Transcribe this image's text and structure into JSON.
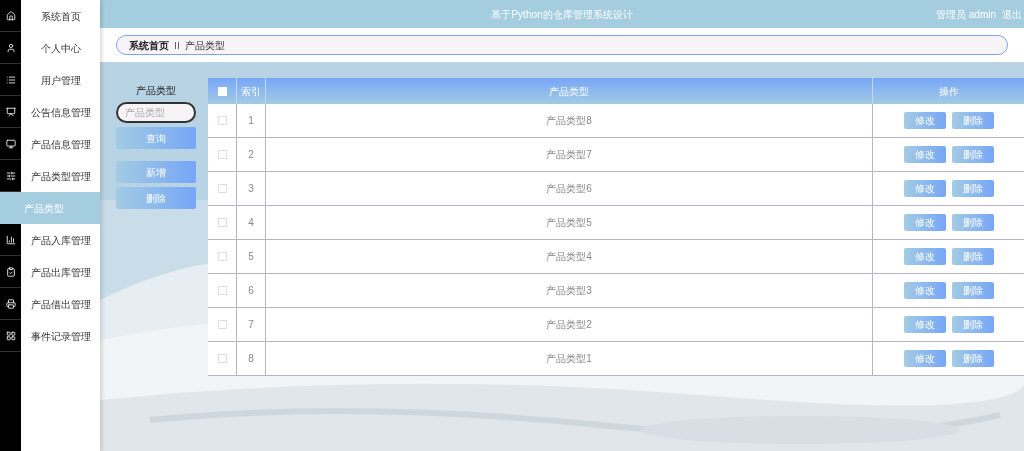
{
  "header": {
    "title": "基于Python的仓库管理系统设计",
    "user": "管理员 admin",
    "logout": "退出"
  },
  "sidebar": {
    "items": [
      {
        "label": "系统首页",
        "selected": false
      },
      {
        "label": "个人中心",
        "selected": false
      },
      {
        "label": "用户管理",
        "selected": false
      },
      {
        "label": "公告信息管理",
        "selected": false
      },
      {
        "label": "产品信息管理",
        "selected": false
      },
      {
        "label": "产品类型管理",
        "selected": false,
        "expanded": true,
        "children": [
          {
            "label": "产品类型",
            "selected": true
          }
        ]
      },
      {
        "label": "产品入库管理",
        "selected": false
      },
      {
        "label": "产品出库管理",
        "selected": false
      },
      {
        "label": "产品借出管理",
        "selected": false
      },
      {
        "label": "事件记录管理",
        "selected": false
      }
    ]
  },
  "breadcrumb": [
    "系统首页",
    "产品类型"
  ],
  "search": {
    "label": "产品类型",
    "placeholder": "产品类型",
    "button": "查询"
  },
  "actions": [
    "新增",
    "删除"
  ],
  "table": {
    "columns": [
      "索引",
      "产品类型",
      "操作"
    ],
    "all_checked": false,
    "rows": [
      {
        "index": "1",
        "type": "产品类型8",
        "checked": false,
        "actions": [
          "修改",
          "删除"
        ]
      },
      {
        "index": "2",
        "type": "产品类型7",
        "checked": false,
        "actions": [
          "修改",
          "删除"
        ]
      },
      {
        "index": "3",
        "type": "产品类型6",
        "checked": false,
        "actions": [
          "修改",
          "删除"
        ]
      },
      {
        "index": "4",
        "type": "产品类型5",
        "checked": false,
        "actions": [
          "修改",
          "删除"
        ]
      },
      {
        "index": "5",
        "type": "产品类型4",
        "checked": false,
        "actions": [
          "修改",
          "删除"
        ]
      },
      {
        "index": "6",
        "type": "产品类型3",
        "checked": false,
        "actions": [
          "修改",
          "删除"
        ]
      },
      {
        "index": "7",
        "type": "产品类型2",
        "checked": false,
        "actions": [
          "修改",
          "删除"
        ]
      },
      {
        "index": "8",
        "type": "产品类型1",
        "checked": false,
        "actions": [
          "修改",
          "删除"
        ]
      }
    ]
  }
}
